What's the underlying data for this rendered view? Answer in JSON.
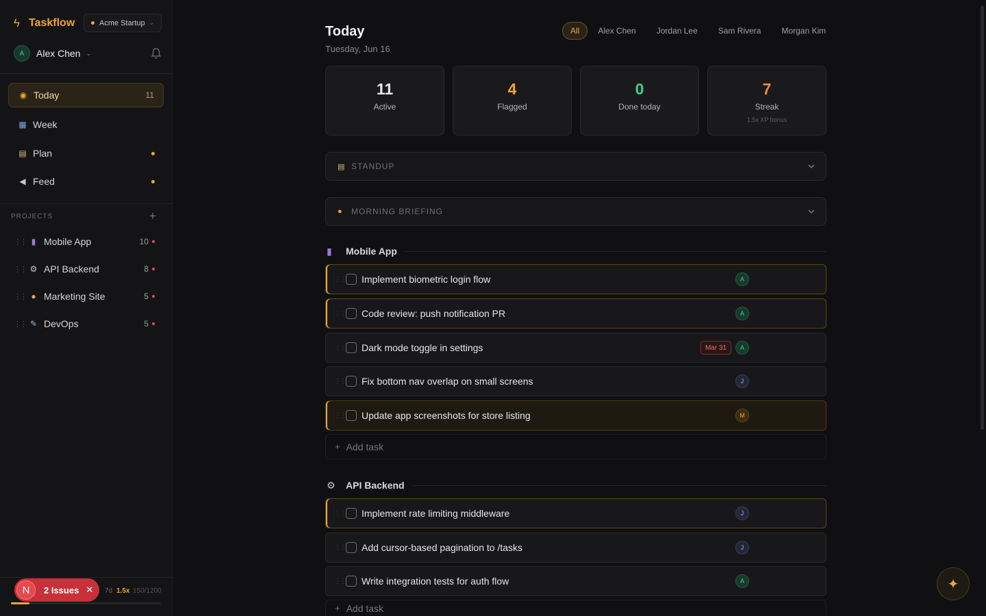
{
  "sidebar": {
    "brand": "Taskflow",
    "workspace": "Acme Startup",
    "user": {
      "initial": "A",
      "name": "Alex Chen"
    },
    "nav": [
      {
        "label": "Today",
        "icon": "sun-icon",
        "count": "11"
      },
      {
        "label": "Week",
        "icon": "calendar-icon"
      },
      {
        "label": "Plan",
        "icon": "clipboard-icon"
      },
      {
        "label": "Feed",
        "icon": "megaphone-icon"
      }
    ],
    "projects_heading": "PROJECTS",
    "projects": [
      {
        "name": "Mobile App",
        "icon": "phone-icon",
        "count": "10"
      },
      {
        "name": "API Backend",
        "icon": "gear-icon",
        "count": "8"
      },
      {
        "name": "Marketing Site",
        "icon": "palette-icon",
        "count": "5"
      },
      {
        "name": "DevOps",
        "icon": "wrench-icon",
        "count": "5"
      }
    ],
    "xp": {
      "streak": "7d",
      "multiplier": "1.5x",
      "value": "150/1200",
      "progress": 0.125
    },
    "issues_badge": {
      "logo": "N",
      "label": "2 Issues"
    }
  },
  "main": {
    "title": "Today",
    "date": "Tuesday, Jun 16",
    "filters": [
      "All",
      "Alex Chen",
      "Jordan Lee",
      "Sam Rivera",
      "Morgan Kim"
    ],
    "stats": [
      {
        "value": "11",
        "label": "Active",
        "color": "#e8e8e8"
      },
      {
        "value": "4",
        "label": "Flagged",
        "color": "#f0a531"
      },
      {
        "value": "0",
        "label": "Done today",
        "color": "#3ecf8e"
      },
      {
        "value": "7",
        "label": "Streak",
        "sub": "1.5x XP bonus",
        "color": "#f08a3a"
      }
    ],
    "sections": {
      "standup": "STANDUP",
      "briefing": "MORNING BRIEFING"
    },
    "groups": [
      {
        "name": "Mobile App",
        "tasks": [
          {
            "title": "Implement biometric login flow",
            "assignee": "A"
          },
          {
            "title": "Code review: push notification PR",
            "assignee": "A"
          },
          {
            "title": "Dark mode toggle in settings",
            "assignee": "A",
            "due": "Mar 31"
          },
          {
            "title": "Fix bottom nav overlap on small screens",
            "assignee": "J"
          },
          {
            "title": "Update app screenshots for store listing",
            "assignee": "M"
          }
        ],
        "add_label": "Add task"
      },
      {
        "name": "API Backend",
        "tasks": [
          {
            "title": "Implement rate limiting middleware",
            "assignee": "J"
          },
          {
            "title": "Add cursor-based pagination to /tasks",
            "assignee": "J"
          },
          {
            "title": "Write integration tests for auth flow",
            "assignee": "A"
          }
        ],
        "add_label": "Add task"
      }
    ]
  },
  "colors": {
    "accent": "#f0a531",
    "danger": "#e5484d",
    "success": "#3ecf8e"
  }
}
